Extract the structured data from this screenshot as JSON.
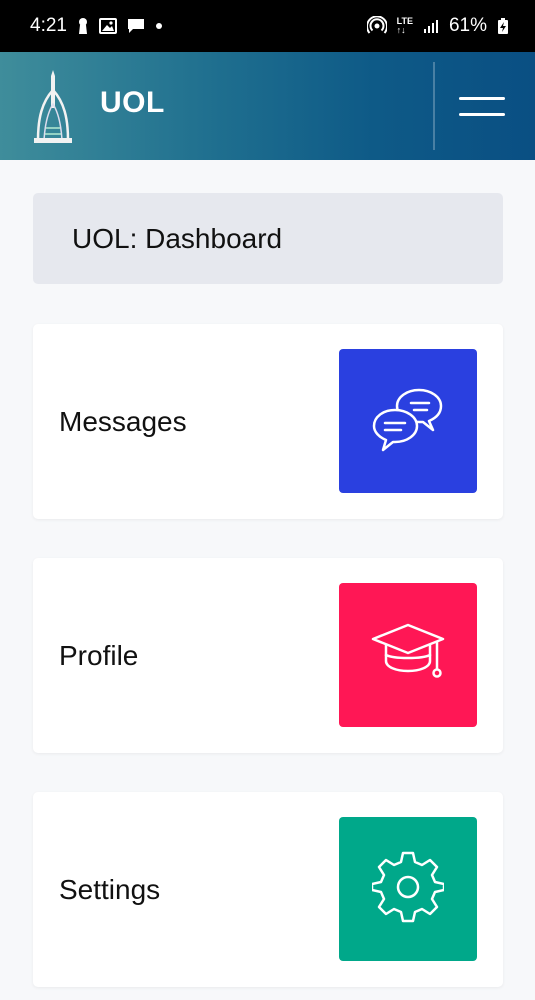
{
  "status_bar": {
    "time": "4:21",
    "lte_top": "LTE",
    "lte_bottom": "↑↓",
    "battery": "61%"
  },
  "app_bar": {
    "title": "UOL",
    "logo_icon": "monument-logo-icon",
    "menu_icon": "hamburger-menu-icon"
  },
  "dashboard": {
    "title": "UOL: Dashboard"
  },
  "cards": [
    {
      "label": "Messages",
      "icon": "chat-bubbles-icon",
      "color": "#2a40e0"
    },
    {
      "label": "Profile",
      "icon": "graduation-cap-icon",
      "color": "#ff1755"
    },
    {
      "label": "Settings",
      "icon": "gear-icon",
      "color": "#00a88a"
    }
  ]
}
